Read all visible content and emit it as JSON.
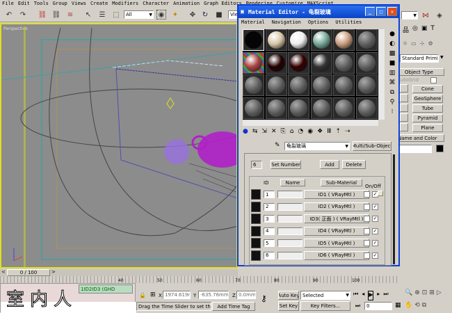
{
  "menu": [
    "File",
    "Edit",
    "Tools",
    "Group",
    "Views",
    "Create",
    "Modifiers",
    "Character",
    "Animation",
    "Graph Editors",
    "Rendering",
    "Customize",
    "MAXScript"
  ],
  "toolbar": {
    "selection_filter": "All",
    "view_dropdown": "View"
  },
  "viewport": {
    "label": "Perspective"
  },
  "material_editor": {
    "title": "Material Editor - 龟裂玻璃",
    "menu": [
      "Material",
      "Navigation",
      "Options",
      "Utilities"
    ],
    "material_name": "龟裂玻璃",
    "material_type": "Multi/Sub-Object",
    "count": "6",
    "set_number": "Set Number",
    "add": "Add",
    "delete": "Delete",
    "headers": {
      "id": "ID",
      "name": "Name",
      "sub": "Sub-Material",
      "onoff": "On/Off"
    },
    "rows": [
      {
        "id": "1",
        "name": "",
        "sub": "ID1 ( VRayMtl )",
        "on": true
      },
      {
        "id": "2",
        "name": "",
        "sub": "ID2 ( VRayMtl )",
        "on": true
      },
      {
        "id": "3",
        "name": "",
        "sub": "ID3( 正面 ) ( VRayMtl )",
        "on": true
      },
      {
        "id": "4",
        "name": "",
        "sub": "ID4 ( VRayMtl )",
        "on": true
      },
      {
        "id": "5",
        "name": "",
        "sub": "ID5 ( VRayMtl )",
        "on": true
      },
      {
        "id": "6",
        "name": "",
        "sub": "ID6 ( VRayMtl )",
        "on": true
      }
    ]
  },
  "command_panel": {
    "category": "Standard Primitives",
    "rollout_object_type": "Object Type",
    "autogrid": "AutoGrid",
    "buttons": [
      "Cone",
      "GeoSphere",
      "Tube",
      "Pyramid",
      "Plane"
    ],
    "rollout_name_color": "Name and Color",
    "color": "#000000"
  },
  "timeline": {
    "slider": "0 / 100",
    "ticks": [
      "40",
      "50",
      "60",
      "70",
      "80",
      "90",
      "100"
    ]
  },
  "status": {
    "watermark": "室内人",
    "script_text": "1ID2ID3 (GHD",
    "x": "1974.619r",
    "y": "-635.76mm",
    "z": "0.0mm",
    "prompt": "Drag the Time Slider to set the cur",
    "add_time_tag": "Add Time Tag",
    "auto_key": "Auto Key",
    "key_mode": "Selected",
    "set_key": "Set Key",
    "key_filters": "Key Filters...",
    "frame": "0"
  }
}
